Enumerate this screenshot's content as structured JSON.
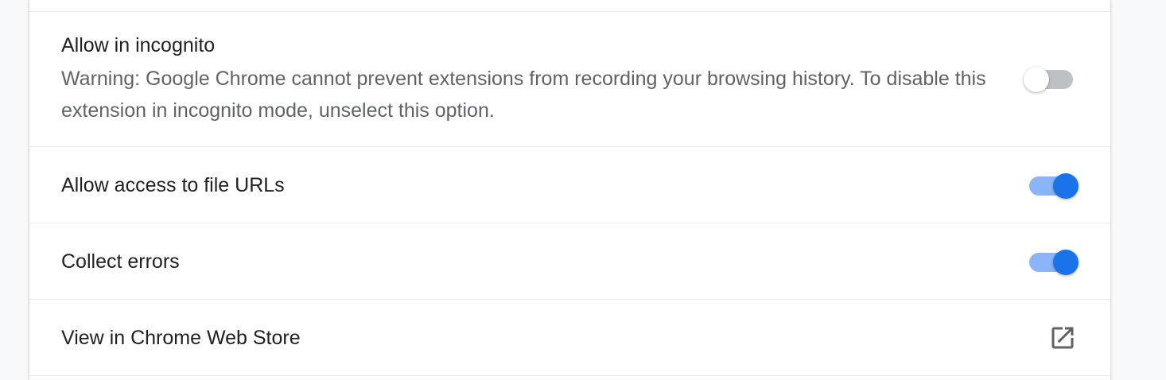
{
  "settings": {
    "incognito": {
      "title": "Allow in incognito",
      "description": "Warning: Google Chrome cannot prevent extensions from recording your browsing history. To disable this extension in incognito mode, unselect this option.",
      "enabled": false
    },
    "file_urls": {
      "title": "Allow access to file URLs",
      "enabled": true
    },
    "collect_errors": {
      "title": "Collect errors",
      "enabled": true
    },
    "web_store": {
      "title": "View in Chrome Web Store",
      "icon": "open-in-new-icon"
    }
  },
  "colors": {
    "toggle_on_knob": "#1a73e8",
    "toggle_on_track": "#8ab4f8",
    "toggle_off_track": "#bdc1c6",
    "title_text": "#202124",
    "secondary_text": "#5f6368"
  }
}
